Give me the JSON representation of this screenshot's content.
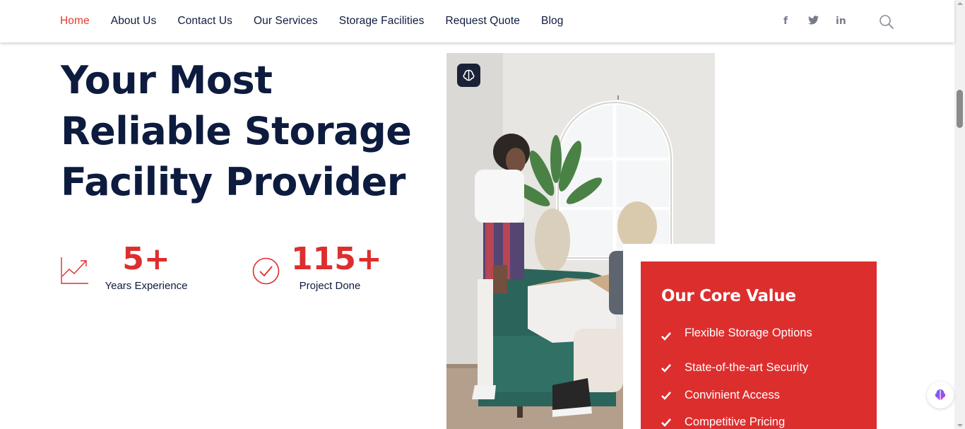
{
  "nav": {
    "items": [
      {
        "label": "Home",
        "active": true
      },
      {
        "label": "About Us"
      },
      {
        "label": "Contact Us"
      },
      {
        "label": "Our Services"
      },
      {
        "label": "Storage Facilities"
      },
      {
        "label": "Request Quote"
      },
      {
        "label": "Blog"
      }
    ],
    "social": [
      "facebook-icon",
      "twitter-icon",
      "linkedin-icon"
    ],
    "social_glyphs": {
      "facebook": "f",
      "twitter": "t",
      "linkedin": "in"
    }
  },
  "hero": {
    "title_lines": [
      "Your Most",
      "Reliable Storage",
      "Facility Provider"
    ]
  },
  "stats": [
    {
      "value": "5+",
      "label": "Years Experience",
      "icon": "chart-growth-icon"
    },
    {
      "value": "115+",
      "label": "Project Done",
      "icon": "check-circle-icon"
    }
  ],
  "core_value": {
    "title": "Our Core Value",
    "items": [
      "Flexible Storage Options",
      "State-of-the-art Security",
      "Convinient Access",
      "Competitive Pricing"
    ]
  },
  "colors": {
    "accent": "#dd2e2e",
    "nav_active": "#e03b2f",
    "navy": "#0d1b3e",
    "icon_gray": "#777b8c"
  }
}
